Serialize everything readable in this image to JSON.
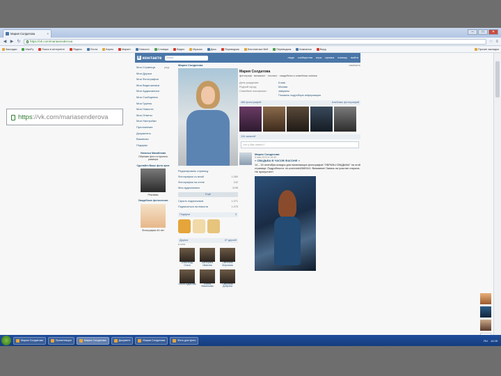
{
  "browser": {
    "tab_title": "Мария Солдатова",
    "tab_close": "×",
    "url": "https://vk.com/mariasenderova",
    "bookmarks": [
      "Закладки",
      "IrfanFy",
      "Поиск в интернете",
      "Яндекс",
      "Почта",
      "Карты",
      "Маркет",
      "Новости",
      "Словари",
      "Видео",
      "Музыка",
      "Диск",
      "Переводчик",
      "Бесплатные Веб",
      "Переводчик",
      "Компания",
      "Ворд",
      "Прочие закладки"
    ],
    "controls": {
      "minimize": "–",
      "maximize": "□",
      "close": "✕"
    }
  },
  "callout": {
    "scheme": "https",
    "rest": "://vk.com/mariasenderova"
  },
  "vk": {
    "logo_mark": "В",
    "logo_text": "контакте",
    "search_placeholder": "Поиск",
    "top_links": [
      "люди",
      "сообщества",
      "игры",
      "музыка",
      "помощь",
      "выйти"
    ],
    "left_menu": [
      {
        "label": "Моя Страница",
        "count": "ред."
      },
      {
        "label": "Мои Друзья",
        "count": ""
      },
      {
        "label": "Мои Фотографии",
        "count": ""
      },
      {
        "label": "Мои Видеозаписи",
        "count": ""
      },
      {
        "label": "Мои Аудиозаписи",
        "count": ""
      },
      {
        "label": "Мои Сообщения",
        "count": ""
      },
      {
        "label": "Мои Группы",
        "count": ""
      },
      {
        "label": "Мои Новости",
        "count": ""
      },
      {
        "label": "Мои Ответы",
        "count": ""
      },
      {
        "label": "Мои Настройки",
        "count": ""
      },
      {
        "label": "Приложения",
        "count": ""
      },
      {
        "label": "Документы",
        "count": ""
      },
      {
        "label": "Вакансии",
        "count": ""
      },
      {
        "label": "Подарки",
        "count": ""
      }
    ],
    "ads": [
      {
        "title": "Наталья Михайлова",
        "text": "Обрезаю фото в нужного размера"
      },
      {
        "title": "Сделайте Ваше фото ярче",
        "text": "Рекламы"
      },
      {
        "title": "Свадебные фотосессии",
        "text": "Фотографии 40 лет"
      }
    ],
    "mid_name": "Мария Солдатова",
    "mid_rows": [
      {
        "label": "Редактировать страницу",
        "count": ""
      },
      {
        "label": "Фотографии со мной",
        "count": "1.060"
      },
      {
        "label": "Фотографии на стене",
        "count": "102"
      },
      {
        "label": "Мои аудиозаписи",
        "count": "1195"
      }
    ],
    "mid_button": "Ещё",
    "mid_links": [
      {
        "label": "Скрыть подписчиков",
        "count": "1.071"
      },
      {
        "label": "Подписаться на новости",
        "count": "1.075"
      }
    ],
    "gifts_title": "Подарки",
    "gifts_count": "3",
    "friends_title": "Друзья",
    "friends_count": "47 друзей",
    "friends_online": "в сети",
    "friends": [
      "Александр Ольга",
      "Екатерина Иванова",
      "Светлана Морозова",
      "Ольга Кудасова",
      "Елена Васильева",
      "Светлана Добрина"
    ],
    "profile": {
      "edited": "изменить",
      "name": "Мария Солдатова",
      "status": "фотограф · визажист · стилист · свадебная и семейная съёмка",
      "info": [
        {
          "k": "День рождения:",
          "v": "6 мая"
        },
        {
          "k": "Родной город:",
          "v": "Москва"
        },
        {
          "k": "Семейное положение:",
          "v": "замужем"
        }
      ],
      "more": "Показать подробную информацию",
      "photos_title": "468 фотографий",
      "photos_link": "Альбомы фотографий",
      "wall_title": "116 записей",
      "wall_placeholder": "Что у Вас нового?",
      "post": {
        "author": "Мария Солдатова",
        "meta": "6 мая 2013 в 15:40",
        "title": "« СВАДЬБА В ЧАСОВ ФАСОНЕ »",
        "text": "14 – 15 сентября конкурс для начинающих фотографов \"ОБРАЗЫ СВАДЬБЫ\" на этой странице. Подробности: vk.com/club42689110. Внимание! Запись на участие открыта. Не пропустите!"
      }
    }
  },
  "taskbar": {
    "items": [
      "Мария Солдатова",
      "Презентация",
      "Мария Солдатова",
      "Документ",
      "Мария Солдатова",
      "Фото для фото"
    ],
    "clock": "14:25",
    "lang": "RU"
  }
}
